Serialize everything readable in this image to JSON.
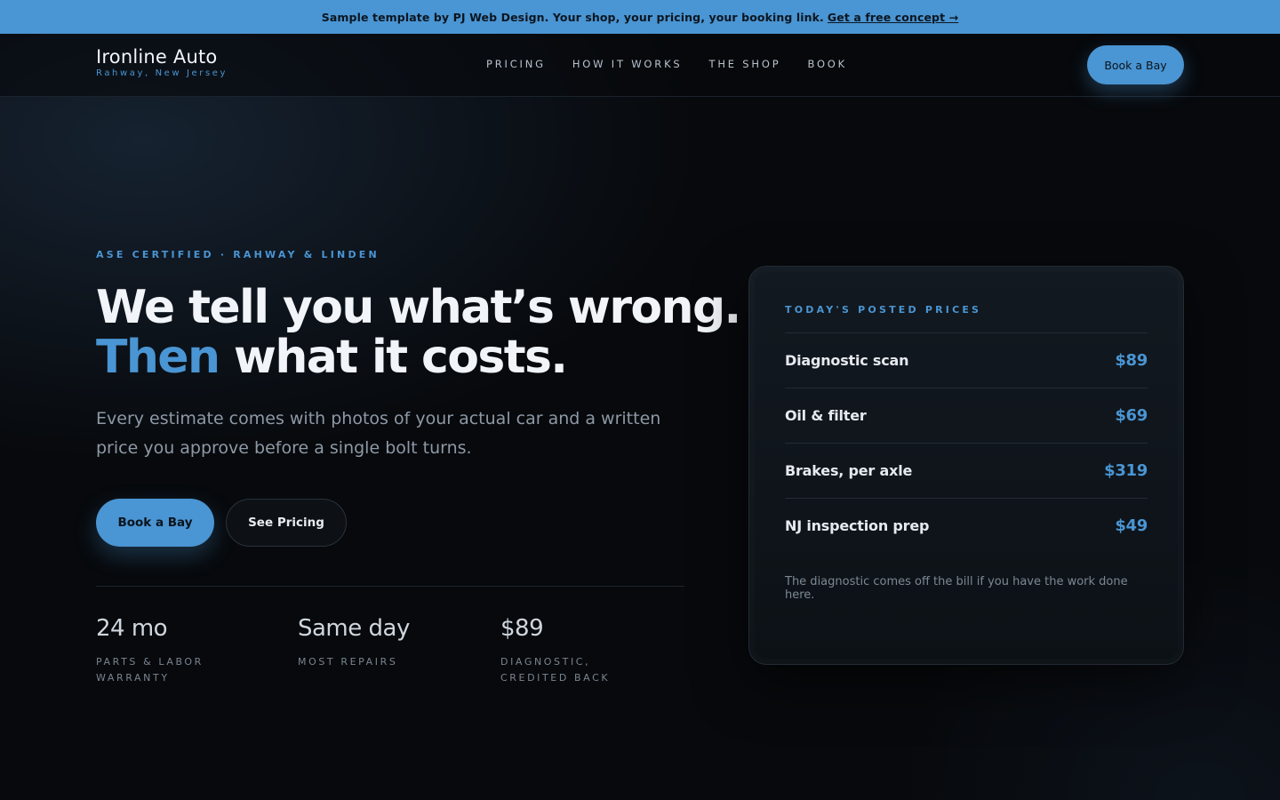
{
  "promo": {
    "text": "Sample template by PJ Web Design. Your shop, your pricing, your booking link.",
    "link": "Get a free concept →"
  },
  "header": {
    "brand_name": "Ironline Auto",
    "brand_location": "Rahway, New Jersey",
    "nav": [
      "PRICING",
      "HOW IT WORKS",
      "THE SHOP",
      "BOOK"
    ],
    "cta": "Book a Bay"
  },
  "hero": {
    "eyebrow": "ASE CERTIFIED · RAHWAY & LINDEN",
    "headline_line1": "We tell you what’s wrong.",
    "headline_accent": "Then",
    "headline_line2_rest": " what it costs.",
    "lede": "Every estimate comes with photos of your actual car and a written price you approve before a single bolt turns.",
    "primary_cta": "Book a Bay",
    "secondary_cta": "See Pricing"
  },
  "stats": [
    {
      "value": "24 mo",
      "label": "PARTS & LABOR WARRANTY"
    },
    {
      "value": "Same day",
      "label": "MOST REPAIRS"
    },
    {
      "value": "$89",
      "label": "DIAGNOSTIC, CREDITED BACK"
    }
  ],
  "price_card": {
    "title": "TODAY'S POSTED PRICES",
    "items": [
      {
        "name": "Diagnostic scan",
        "price": "$89"
      },
      {
        "name": "Oil & filter",
        "price": "$69"
      },
      {
        "name": "Brakes, per axle",
        "price": "$319"
      },
      {
        "name": "NJ inspection prep",
        "price": "$49"
      }
    ],
    "note": "The diagnostic comes off the bill if you have the work done here."
  },
  "colors": {
    "accent": "#4a95d3",
    "background": "#07090c"
  }
}
